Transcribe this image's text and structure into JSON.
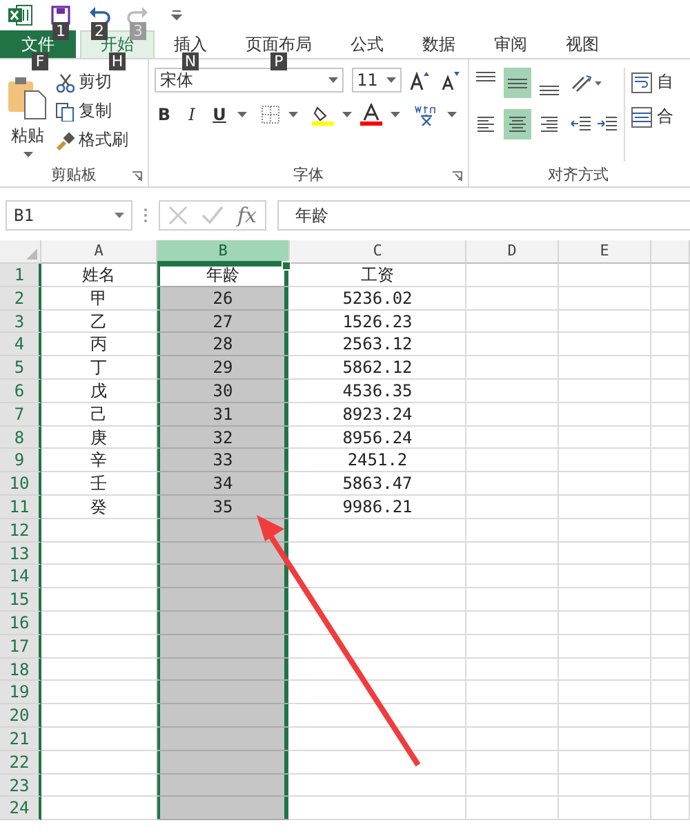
{
  "quick_access": [
    {
      "kind": "save",
      "keytip": "1",
      "disabled": false
    },
    {
      "kind": "undo",
      "keytip": "2",
      "disabled": false
    },
    {
      "kind": "redo",
      "keytip": "3",
      "disabled": true
    }
  ],
  "tabs": [
    {
      "kind": "file",
      "label": "文件",
      "keytip": "F",
      "selected": false
    },
    {
      "kind": "tab",
      "label": "开始",
      "keytip": "H",
      "selected": true
    },
    {
      "kind": "tab",
      "label": "插入",
      "keytip": "N",
      "selected": false
    },
    {
      "kind": "tab",
      "label": "页面布局",
      "keytip": "P",
      "selected": false
    },
    {
      "kind": "tab",
      "label": "公式",
      "selected": false
    },
    {
      "kind": "tab",
      "label": "数据",
      "selected": false
    },
    {
      "kind": "tab",
      "label": "审阅",
      "selected": false
    },
    {
      "kind": "tab",
      "label": "视图",
      "selected": false
    }
  ],
  "clipboard": {
    "paste": "粘贴",
    "cut": "剪切",
    "copy": "复制",
    "format_painter": "格式刷",
    "group_label": "剪贴板"
  },
  "font": {
    "font_name": "宋体",
    "font_size": "11",
    "bold": "B",
    "italic": "I",
    "underline": "U",
    "group_label": "字体"
  },
  "alignment": {
    "vertical": [
      {
        "kind": "top",
        "selected": false
      },
      {
        "kind": "middle",
        "selected": true
      },
      {
        "kind": "bottom",
        "selected": false
      }
    ],
    "horizontal": [
      {
        "kind": "left",
        "selected": false
      },
      {
        "kind": "center",
        "selected": true
      },
      {
        "kind": "right",
        "selected": false
      }
    ],
    "wrap_text": "自",
    "merge": "合",
    "group_label": "对齐方式"
  },
  "formula_bar": {
    "name_box": "B1",
    "function_label": "fx",
    "content": "年龄"
  },
  "sheet": {
    "columns": [
      {
        "label": "A",
        "selected": false
      },
      {
        "label": "B",
        "selected": true
      },
      {
        "label": "C",
        "selected": false
      },
      {
        "label": "D",
        "selected": false
      },
      {
        "label": "E",
        "selected": false
      }
    ],
    "rows": [
      {
        "number": "1",
        "cells": [
          "姓名",
          "年龄",
          "工资"
        ]
      },
      {
        "number": "2",
        "cells": [
          "甲",
          "26",
          "5236.02"
        ]
      },
      {
        "number": "3",
        "cells": [
          "乙",
          "27",
          "1526.23"
        ]
      },
      {
        "number": "4",
        "cells": [
          "丙",
          "28",
          "2563.12"
        ]
      },
      {
        "number": "5",
        "cells": [
          "丁",
          "29",
          "5862.12"
        ]
      },
      {
        "number": "6",
        "cells": [
          "戊",
          "30",
          "4536.35"
        ]
      },
      {
        "number": "7",
        "cells": [
          "己",
          "31",
          "8923.24"
        ]
      },
      {
        "number": "8",
        "cells": [
          "庚",
          "32",
          "8956.24"
        ]
      },
      {
        "number": "9",
        "cells": [
          "辛",
          "33",
          "2451.2"
        ]
      },
      {
        "number": "10",
        "cells": [
          "壬",
          "34",
          "5863.47"
        ]
      },
      {
        "number": "11",
        "cells": [
          "癸",
          "35",
          "9986.21"
        ]
      },
      {
        "number": "12"
      },
      {
        "number": "13"
      },
      {
        "number": "14"
      },
      {
        "number": "15"
      },
      {
        "number": "16"
      },
      {
        "number": "17"
      },
      {
        "number": "18"
      },
      {
        "number": "19"
      },
      {
        "number": "20"
      },
      {
        "number": "21"
      },
      {
        "number": "22"
      },
      {
        "number": "23"
      },
      {
        "number": "24"
      }
    ]
  }
}
